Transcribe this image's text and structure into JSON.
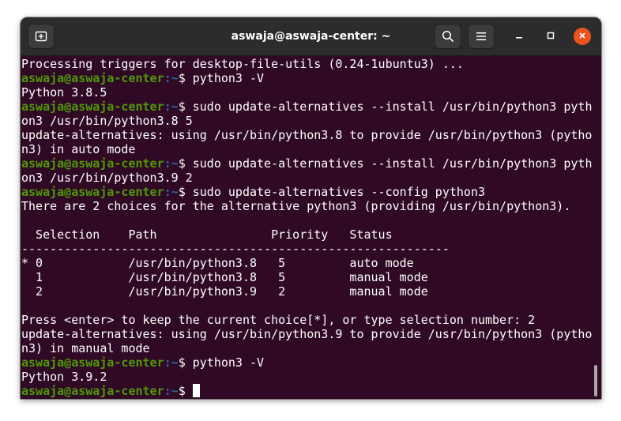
{
  "window": {
    "title": "aswaja@aswaja-center: ~"
  },
  "titlebar": {
    "new_tab_icon": "new-tab-icon",
    "search_icon": "search-icon",
    "menu_icon": "hamburger-menu-icon",
    "minimize_icon": "minimize-icon",
    "maximize_icon": "maximize-icon",
    "close_icon": "close-icon",
    "close_color": "#e95420"
  },
  "colors": {
    "background": "#300a24",
    "text": "#ffffff",
    "prompt_user": "#4e9a06",
    "prompt_path": "#3465a4"
  },
  "terminal": {
    "lines": [
      {
        "type": "out",
        "text": "Processing triggers for desktop-file-utils (0.24-1ubuntu3) ..."
      },
      {
        "type": "prompt",
        "user": "aswaja@aswaja-center",
        "path": ":~",
        "sym": "$ ",
        "cmd": "python3 -V"
      },
      {
        "type": "out",
        "text": "Python 3.8.5"
      },
      {
        "type": "prompt",
        "user": "aswaja@aswaja-center",
        "path": ":~",
        "sym": "$ ",
        "cmd": "sudo update-alternatives --install /usr/bin/python3 pyth"
      },
      {
        "type": "out",
        "text": "on3 /usr/bin/python3.8 5"
      },
      {
        "type": "out",
        "text": "update-alternatives: using /usr/bin/python3.8 to provide /usr/bin/python3 (pytho"
      },
      {
        "type": "out",
        "text": "n3) in auto mode"
      },
      {
        "type": "prompt",
        "user": "aswaja@aswaja-center",
        "path": ":~",
        "sym": "$ ",
        "cmd": "sudo update-alternatives --install /usr/bin/python3 pyth"
      },
      {
        "type": "out",
        "text": "on3 /usr/bin/python3.9 2"
      },
      {
        "type": "prompt",
        "user": "aswaja@aswaja-center",
        "path": ":~",
        "sym": "$ ",
        "cmd": "sudo update-alternatives --config python3"
      },
      {
        "type": "out",
        "text": "There are 2 choices for the alternative python3 (providing /usr/bin/python3)."
      },
      {
        "type": "out",
        "text": ""
      },
      {
        "type": "out",
        "text": "  Selection    Path                Priority   Status"
      },
      {
        "type": "out",
        "text": "------------------------------------------------------------"
      },
      {
        "type": "out",
        "text": "* 0            /usr/bin/python3.8   5         auto mode"
      },
      {
        "type": "out",
        "text": "  1            /usr/bin/python3.8   5         manual mode"
      },
      {
        "type": "out",
        "text": "  2            /usr/bin/python3.9   2         manual mode"
      },
      {
        "type": "out",
        "text": ""
      },
      {
        "type": "out",
        "text": "Press <enter> to keep the current choice[*], or type selection number: 2"
      },
      {
        "type": "out",
        "text": "update-alternatives: using /usr/bin/python3.9 to provide /usr/bin/python3 (pytho"
      },
      {
        "type": "out",
        "text": "n3) in manual mode"
      },
      {
        "type": "prompt",
        "user": "aswaja@aswaja-center",
        "path": ":~",
        "sym": "$ ",
        "cmd": "python3 -V"
      },
      {
        "type": "out",
        "text": "Python 3.9.2"
      },
      {
        "type": "prompt",
        "user": "aswaja@aswaja-center",
        "path": ":~",
        "sym": "$ ",
        "cmd": "",
        "cursor": true
      }
    ]
  }
}
